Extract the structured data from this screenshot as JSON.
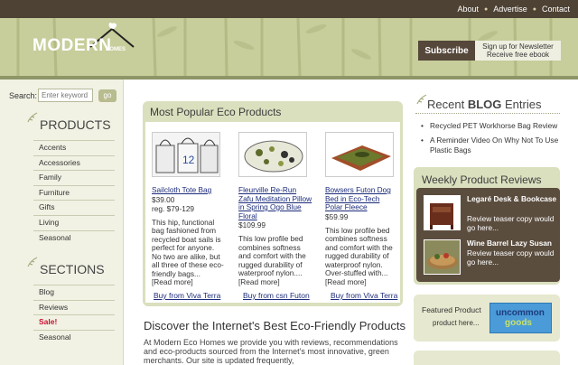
{
  "topnav": {
    "about": "About",
    "advertise": "Advertise",
    "contact": "Contact"
  },
  "logo": {
    "text": "MODERN",
    "sub": "HOMES"
  },
  "subscribe": {
    "button": "Subscribe",
    "line1": "Sign up for Newsletter",
    "line2": "Receive free ebook"
  },
  "search": {
    "label": "Search:",
    "placeholder": "Enter keyword",
    "go": "go"
  },
  "sidebar": {
    "products_title": "PRODUCTS",
    "products": [
      "Accents",
      "Accessories",
      "Family",
      "Furniture",
      "Gifts",
      "Living",
      "Seasonal"
    ],
    "sections_title": "SECTIONS",
    "sections": [
      "Blog",
      "Reviews",
      "Sale!",
      "Seasonal"
    ]
  },
  "popular": {
    "title": "Most Popular Eco Products",
    "items": [
      {
        "name": "Sailcloth Tote Bag",
        "price": "$39.00",
        "reg": "reg. $79-129",
        "desc": "This hip, functional bag fashioned from recycled boat sails is perfect for anyone. No two are alike, but all three of these eco-friendly bags...",
        "more": "[Read more]",
        "buy": "Buy from Viva Terra"
      },
      {
        "name": "Fleurville Re-Run Zafu Meditation Pillow in Spring Ogo Blue Floral",
        "price": "$109.99",
        "reg": "",
        "desc": "This low profile bed combines softness and comfort with the rugged durability of waterproof nylon....",
        "more": "[Read more]",
        "buy": "Buy from csn Futon"
      },
      {
        "name": "Bowsers Futon Dog Bed in Eco-Tech Polar Fleece",
        "price": "$59.99",
        "reg": "",
        "desc": "This low profile bed combines softness and comfort with the rugged durability of waterproof nylon. Over-stuffed with...",
        "more": "[Read more]",
        "buy": "Buy from Viva Terra"
      }
    ]
  },
  "discover": {
    "title": "Discover the Internet's Best Eco-Friendly Products",
    "text": "At Modern Eco Homes we provide you with reviews, recommendations and eco-products sourced from the Internet's most innovative, green merchants. Our site is updated frequently,"
  },
  "recent": {
    "title_prefix": "Recent ",
    "title_bold": "BLOG",
    "title_suffix": " Entries",
    "items": [
      "Recycled PET Workhorse Bag Review",
      "A Reminder Video On Why Not To Use Plastic Bags"
    ]
  },
  "weekly": {
    "title": "Weekly Product Reviews",
    "items": [
      {
        "name": "Legaré Desk & Bookcase",
        "text": "Review teaser copy would go here..."
      },
      {
        "name": "Wine Barrel Lazy Susan",
        "text": "Review teaser copy would go here..."
      }
    ]
  },
  "featured": {
    "title": "Featured Product",
    "sub": "product here...",
    "logo_line1": "uncommon",
    "logo_line2": "goods"
  },
  "colors": {
    "topbar": "#4e4234",
    "banner": "#c7cd9b",
    "panel": "#dadfbe",
    "link": "#1c2c7a",
    "sale": "#c8102e"
  }
}
